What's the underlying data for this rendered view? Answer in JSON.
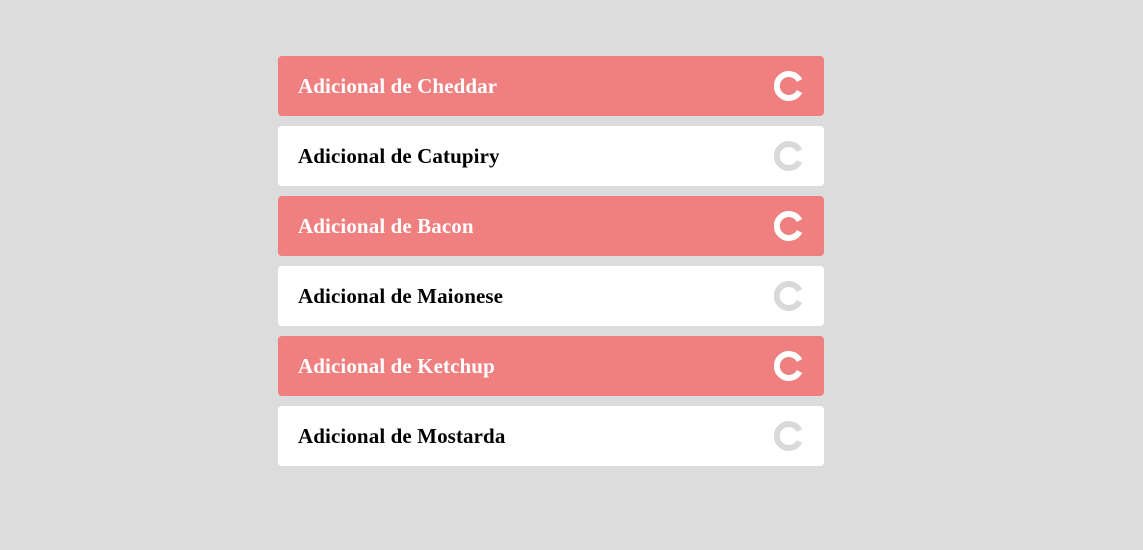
{
  "addons": {
    "items": [
      {
        "label": "Adicional de Cheddar",
        "selected": true,
        "icon": "toggle-icon"
      },
      {
        "label": "Adicional de Catupiry",
        "selected": false,
        "icon": "toggle-icon"
      },
      {
        "label": "Adicional de Bacon",
        "selected": true,
        "icon": "toggle-icon"
      },
      {
        "label": "Adicional de Maionese",
        "selected": false,
        "icon": "toggle-icon"
      },
      {
        "label": "Adicional de Ketchup",
        "selected": true,
        "icon": "toggle-icon"
      },
      {
        "label": "Adicional de Mostarda",
        "selected": false,
        "icon": "toggle-icon"
      }
    ]
  },
  "colors": {
    "background": "#dcdcdc",
    "selected_bg": "#f08080",
    "unselected_bg": "#ffffff",
    "icon_light": "#ffffff",
    "icon_gray": "#d9d9d9"
  }
}
